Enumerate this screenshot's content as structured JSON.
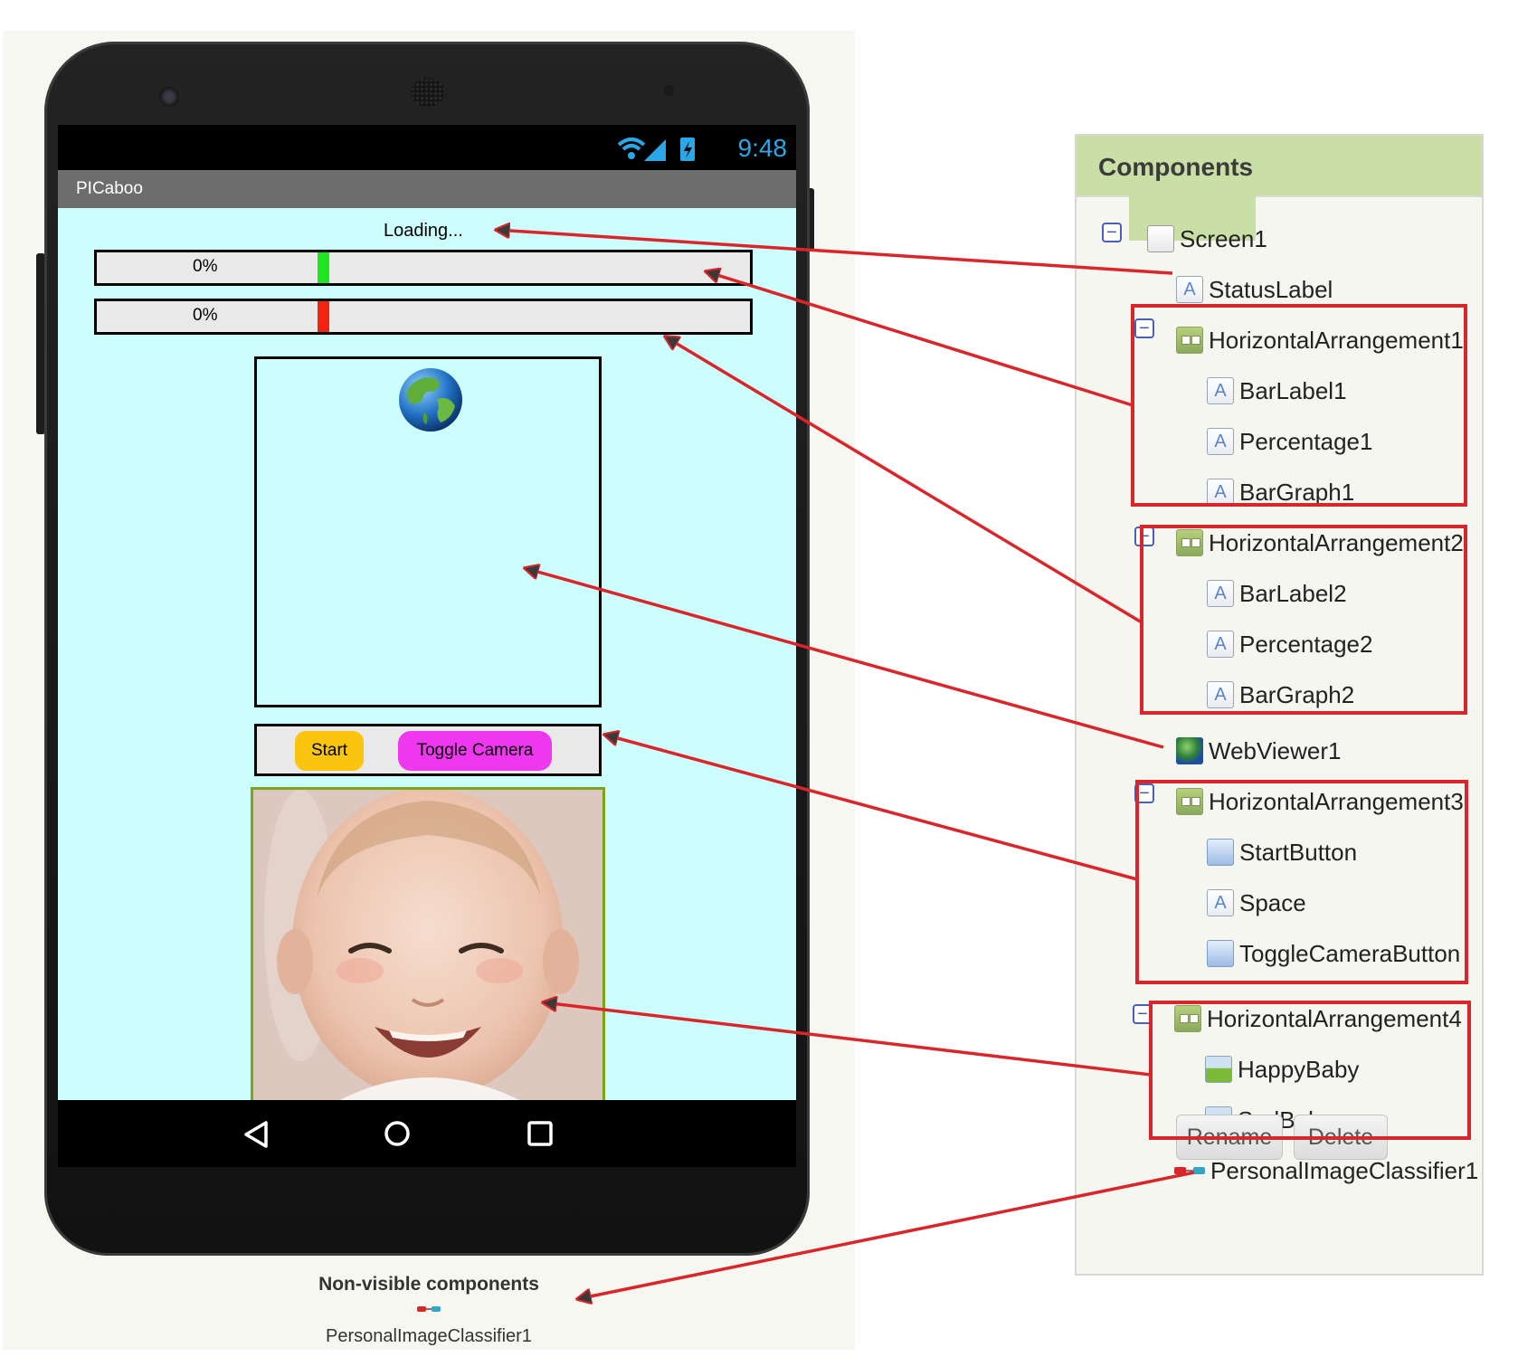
{
  "phone": {
    "status_bar": {
      "time": "9:48"
    },
    "app_title": "PICaboo",
    "status_label": "Loading...",
    "bars": [
      {
        "percentage": "0%",
        "color": "#1ee51e"
      },
      {
        "percentage": "0%",
        "color": "#f2230f"
      }
    ],
    "buttons": {
      "start": "Start",
      "toggle_camera": "Toggle Camera"
    },
    "non_visible": {
      "title": "Non-visible components",
      "item": "PersonalImageClassifier1"
    }
  },
  "components": {
    "title": "Components",
    "tree": [
      {
        "label": "Screen1",
        "icon": "screen-icon"
      },
      {
        "label": "StatusLabel",
        "icon": "label-icon"
      },
      {
        "label": "HorizontalArrangement1",
        "icon": "horizontal-arrangement-icon"
      },
      {
        "label": "BarLabel1",
        "icon": "label-icon"
      },
      {
        "label": "Percentage1",
        "icon": "label-icon"
      },
      {
        "label": "BarGraph1",
        "icon": "label-icon"
      },
      {
        "label": "HorizontalArrangement2",
        "icon": "horizontal-arrangement-icon"
      },
      {
        "label": "BarLabel2",
        "icon": "label-icon"
      },
      {
        "label": "Percentage2",
        "icon": "label-icon"
      },
      {
        "label": "BarGraph2",
        "icon": "label-icon"
      },
      {
        "label": "WebViewer1",
        "icon": "webviewer-icon"
      },
      {
        "label": "HorizontalArrangement3",
        "icon": "horizontal-arrangement-icon"
      },
      {
        "label": "StartButton",
        "icon": "button-icon"
      },
      {
        "label": "Space",
        "icon": "label-icon"
      },
      {
        "label": "ToggleCameraButton",
        "icon": "button-icon"
      },
      {
        "label": "HorizontalArrangement4",
        "icon": "horizontal-arrangement-icon"
      },
      {
        "label": "HappyBaby",
        "icon": "image-icon"
      },
      {
        "label": "SadBaby",
        "icon": "image-icon"
      },
      {
        "label": "PersonalImageClassifier1",
        "icon": "classifier-icon"
      }
    ],
    "rename_label": "Rename",
    "delete_label": "Delete"
  },
  "colors": {
    "app_background": "#ccfefe",
    "start_button": "#fbc40f",
    "toggle_camera_button": "#ef37f0",
    "annotation": "#d9262a",
    "panel_header": "#c9dfa6"
  }
}
